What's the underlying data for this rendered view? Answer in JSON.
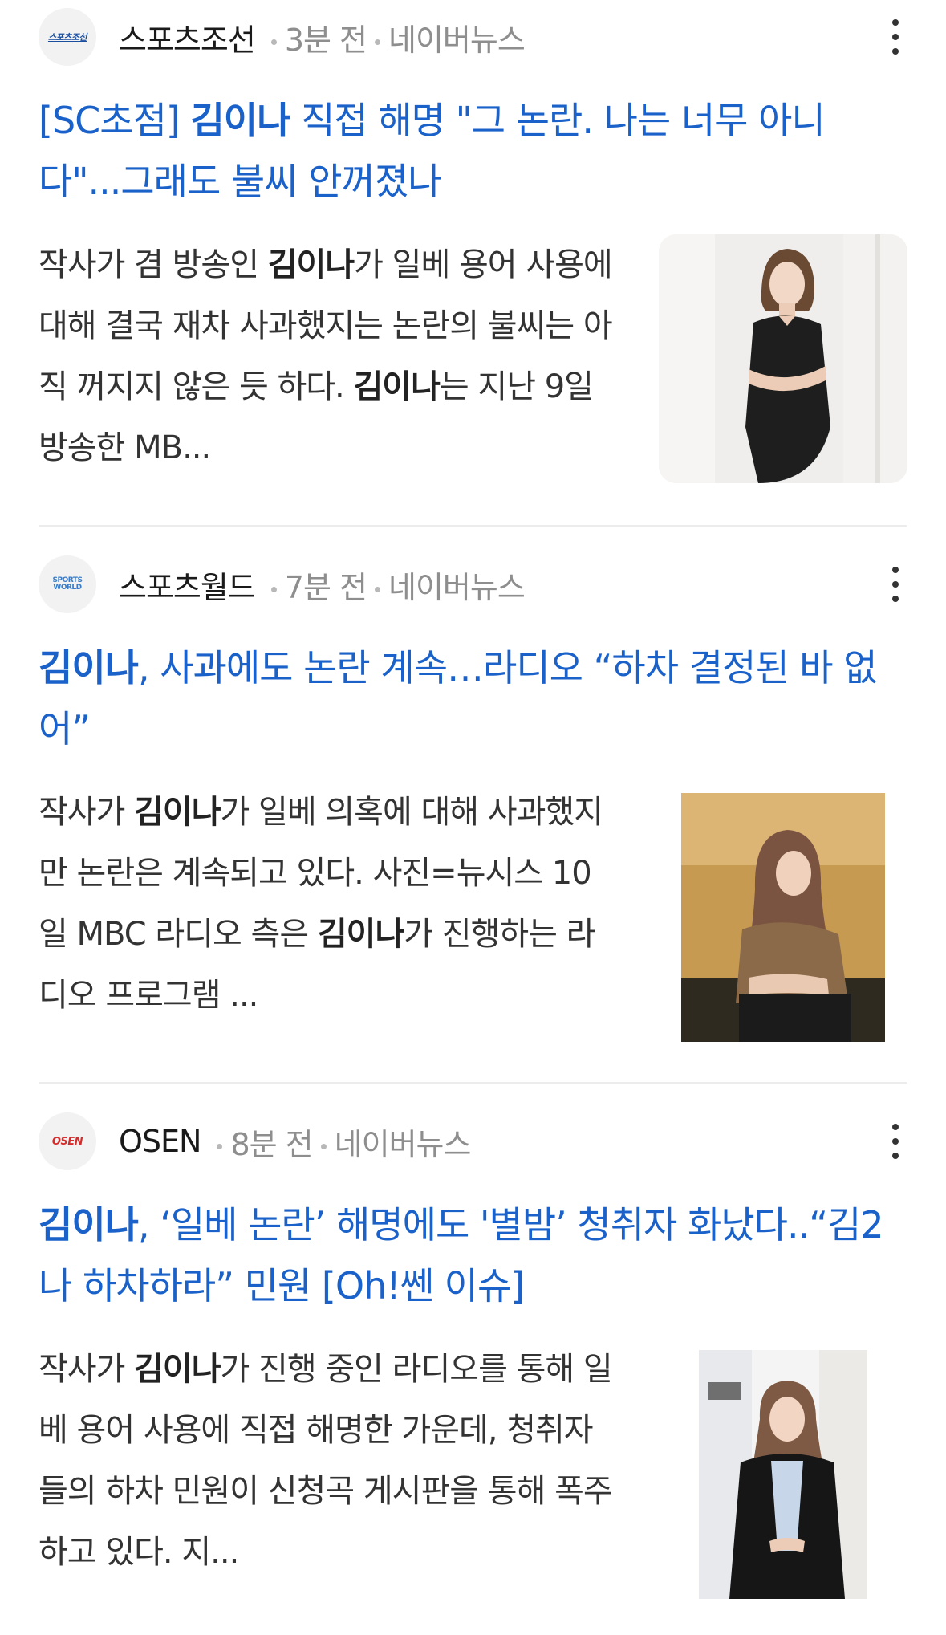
{
  "articles": [
    {
      "source": "스포츠조선",
      "logo_text": "스포츠조선",
      "time": "3분 전",
      "platform": "네이버뉴스",
      "headline_pre": "[SC초점] ",
      "headline_bold": "김이나",
      "headline_post": " 직접 해명 \"그 논란. 나는 너무 아니다\"...그래도 불씨 안꺼졌나",
      "snippet_pre": "작사가 겸 방송인 ",
      "snippet_bold1": "김이나",
      "snippet_mid": "가 일베 용어 사용에 대해 결국 재차 사과했지는 논란의 불씨는 아직 꺼지지 않은 듯 하다. ",
      "snippet_bold2": "김이나",
      "snippet_post": "는 지난 9일 방송한 MB..."
    },
    {
      "source": "스포츠월드",
      "logo_text": "SPORTS WORLD",
      "time": "7분 전",
      "platform": "네이버뉴스",
      "headline_pre": "",
      "headline_bold": "김이나",
      "headline_post": ", 사과에도 논란 계속…라디오 “하차 결정된 바 없어”",
      "snippet_pre": "작사가 ",
      "snippet_bold1": "김이나",
      "snippet_mid": "가 일베 의혹에 대해 사과했지만 논란은 계속되고 있다. 사진=뉴시스 10일 MBC 라디오 측은 ",
      "snippet_bold2": "김이나",
      "snippet_post": "가 진행하는 라디오 프로그램 ..."
    },
    {
      "source": "OSEN",
      "logo_text": "OSEN",
      "time": "8분 전",
      "platform": "네이버뉴스",
      "headline_pre": "",
      "headline_bold": "김이나",
      "headline_post": ", ‘일베 논란’ 해명에도 '별밤’ 청취자 화났다..“김2나 하차하라” 민원 [Oh!쎈 이슈]",
      "snippet_pre": "작사가 ",
      "snippet_bold1": "김이나",
      "snippet_mid": "가 진행 중인 라디오를 통해 일베 용어 사용에 직접 해명한 가운데, 청취자들의 하차 민원이 신청곡 게시판을 통해 폭주하고 있다. 지...",
      "snippet_bold2": "",
      "snippet_post": ""
    }
  ]
}
